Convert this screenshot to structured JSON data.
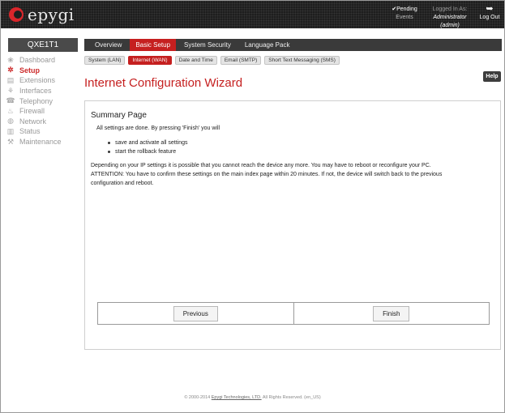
{
  "header": {
    "logo_text": "epygi",
    "pending": {
      "check": "✔",
      "label": "Pending",
      "sub": "Events"
    },
    "logged_in": {
      "label": "Logged In As:",
      "user": "Administrator (admin)"
    },
    "logout": {
      "icon": "logout-arrow-icon",
      "label": "Log Out"
    }
  },
  "device_name": "QXE1T1",
  "sidebar": {
    "items": [
      {
        "label": "Dashboard",
        "icon": "dashboard-icon",
        "glyph": "❀",
        "active": false
      },
      {
        "label": "Setup",
        "icon": "gear-icon",
        "glyph": "✲",
        "active": true
      },
      {
        "label": "Extensions",
        "icon": "extensions-icon",
        "glyph": "▤",
        "active": false
      },
      {
        "label": "Interfaces",
        "icon": "interfaces-icon",
        "glyph": "⚘",
        "active": false
      },
      {
        "label": "Telephony",
        "icon": "phone-icon",
        "glyph": "☎",
        "active": false
      },
      {
        "label": "Firewall",
        "icon": "flame-icon",
        "glyph": "♨",
        "active": false
      },
      {
        "label": "Network",
        "icon": "globe-icon",
        "glyph": "◍",
        "active": false
      },
      {
        "label": "Status",
        "icon": "chart-icon",
        "glyph": "▥",
        "active": false
      },
      {
        "label": "Maintenance",
        "icon": "wrench-icon",
        "glyph": "⚒",
        "active": false
      }
    ]
  },
  "tabs": [
    {
      "label": "Overview",
      "active": false
    },
    {
      "label": "Basic Setup",
      "active": true
    },
    {
      "label": "System Security",
      "active": false
    },
    {
      "label": "Language Pack",
      "active": false
    }
  ],
  "subtabs": [
    {
      "label": "System (LAN)",
      "active": false
    },
    {
      "label": "Internet (WAN)",
      "active": true
    },
    {
      "label": "Date and Time",
      "active": false
    },
    {
      "label": "Email (SMTP)",
      "active": false
    },
    {
      "label": "Short Text Messaging (SMS)",
      "active": false
    }
  ],
  "page_title": "Internet Configuration Wizard",
  "help_label": "Help",
  "summary": {
    "title": "Summary Page",
    "intro": "All settings are done. By pressing 'Finish' you will",
    "bullets": [
      "save and activate all settings",
      "start the rollback feature"
    ],
    "note_line1": "Depending on your IP settings it is possible that you cannot reach the device any more. You may have to reboot or reconfigure your PC.",
    "note_line2": "ATTENTION: You have to confirm these settings on the main index page within 20 minutes. If not, the device will switch back to the previous",
    "note_line3": "configuration and reboot."
  },
  "buttons": {
    "previous": "Previous",
    "finish": "Finish"
  },
  "footer": {
    "prefix": "© 2000-2014 ",
    "company": "Epygi Technologies, LTD.",
    "suffix": " All Rights Reserved. (en_US)"
  },
  "colors": {
    "accent": "#c51f1f",
    "topbar": "#1e1e1e",
    "tabbar": "#3a3a3a"
  }
}
